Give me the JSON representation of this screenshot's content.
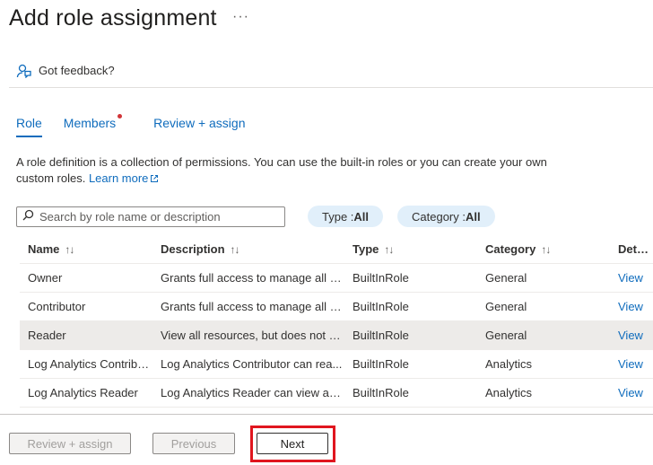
{
  "header": {
    "title": "Add role assignment",
    "more_label": "···"
  },
  "feedback": {
    "label": "Got feedback?"
  },
  "tabs": [
    {
      "label": "Role",
      "active": true
    },
    {
      "label": "Members",
      "has_dot": true
    },
    {
      "label": "Review + assign"
    }
  ],
  "description": {
    "text": "A role definition is a collection of permissions. You can use the built-in roles or you can create your own custom roles.",
    "learn_more": "Learn more"
  },
  "search": {
    "placeholder": "Search by role name or description",
    "value": ""
  },
  "filters": {
    "type": {
      "label": "Type : ",
      "value": "All"
    },
    "category": {
      "label": "Category : ",
      "value": "All"
    }
  },
  "table": {
    "columns": [
      "Name",
      "Description",
      "Type",
      "Category",
      "Details"
    ],
    "sort_glyph": "↑↓",
    "rows": [
      {
        "name": "Owner",
        "description": "Grants full access to manage all re...",
        "type": "BuiltInRole",
        "category": "General",
        "details": "View",
        "selected": false
      },
      {
        "name": "Contributor",
        "description": "Grants full access to manage all re...",
        "type": "BuiltInRole",
        "category": "General",
        "details": "View",
        "selected": false
      },
      {
        "name": "Reader",
        "description": "View all resources, but does not al...",
        "type": "BuiltInRole",
        "category": "General",
        "details": "View",
        "selected": true
      },
      {
        "name": "Log Analytics Contribu...",
        "description": "Log Analytics Contributor can rea...",
        "type": "BuiltInRole",
        "category": "Analytics",
        "details": "View",
        "selected": false
      },
      {
        "name": "Log Analytics Reader",
        "description": "Log Analytics Reader can view an...",
        "type": "BuiltInRole",
        "category": "Analytics",
        "details": "View",
        "selected": false
      }
    ]
  },
  "footer": {
    "review_label": "Review + assign",
    "previous_label": "Previous",
    "next_label": "Next"
  },
  "colors": {
    "accent": "#0f6cbd",
    "highlight_box": "#e0161f",
    "pill_bg": "#e1effa",
    "selected_row": "#edebe9"
  }
}
